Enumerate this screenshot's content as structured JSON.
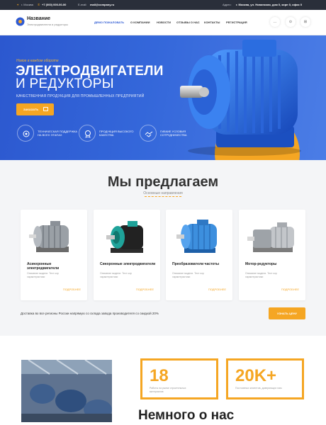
{
  "topbar": {
    "city": "г. Москва",
    "phone": "+7 (000) 000-00-00",
    "email_label": "E-mail:",
    "email": "mail@company.ru",
    "address_label": "Адрес:",
    "address": "г. Москва, ул. Новинская, дом 0, корп 0, офис 0"
  },
  "header": {
    "title": "Название",
    "subtitle": "Электродвигатели и редукторы",
    "nav": [
      "ДЕМО ПОЖАЛОВАТЬ",
      "О КОМПАНИИ",
      "НОВОСТИ",
      "ОТЗЫВЫ О НАС",
      "КОНТАКТЫ",
      "РЕГИСТРАЦИЯ"
    ],
    "icons": [
      "user-icon",
      "search-icon",
      "cart-icon"
    ],
    "icon_glyphs": [
      "…",
      "⊙",
      "⊞"
    ]
  },
  "hero": {
    "kicker": "Новое в каждом обороте",
    "title_line1": "ЭЛЕКТРОДВИГАТЕЛИ",
    "title_line2": "И РЕДУКТОРЫ",
    "subtitle": "КАЧЕСТВЕННАЯ ПРОДУКЦИЯ ДЛЯ ПРОМЫШЛЕННЫХ ПРЕДПРИЯТИЙ",
    "button": "ЗАКАЗАТЬ",
    "features": [
      {
        "text": "ТЕХНИЧЕСКАЯ ПОДДЕРЖКА НА ВСЕХ ЭТАПАХ",
        "icon": "gear-icon"
      },
      {
        "text": "ПРОДУКЦИЯ ВЫСОКОГО КАЧЕСТВА",
        "icon": "medal-icon"
      },
      {
        "text": "ГИБКИЕ УСЛОВИЯ СОТРУДНИЧЕСТВА",
        "icon": "handshake-icon"
      }
    ]
  },
  "offer": {
    "title": "Мы предлагаем",
    "subtitle": "Основные направления",
    "products": [
      {
        "title": "Асинхронные электродвигатели",
        "desc": "Описание модели. Тест кор характеристики",
        "more": "ПОДРОБНЕЕ"
      },
      {
        "title": "Синхронные электродвигатели",
        "desc": "Описание модели. Тест кор характеристики",
        "more": "ПОДРОБНЕЕ"
      },
      {
        "title": "Преобразователи частоты",
        "desc": "Описание модели. Тест кор характеристики",
        "more": "ПОДРОБНЕЕ"
      },
      {
        "title": "Мотор-редукторы",
        "desc": "Описание модели. Тест кор характеристики",
        "more": "ПОДРОБНЕЕ"
      }
    ],
    "delivery": "Доставка во все регионы России напрямую со склада завода производителя со скидкой 20%",
    "calc_button": "УЗНАТЬ ЦЕНУ"
  },
  "about": {
    "title": "Немного о нас",
    "stats": [
      {
        "value": "18",
        "label": "Работы на рынке строительных материалов"
      },
      {
        "value": "20K+",
        "label": "Постоянных клиентов, доверяющих нам"
      }
    ]
  },
  "colors": {
    "accent": "#f5a623",
    "primary": "#2f5bd3"
  }
}
